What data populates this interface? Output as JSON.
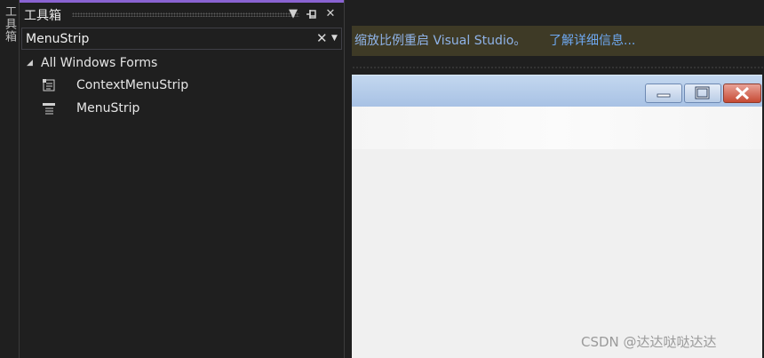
{
  "side_strip": {
    "label": "工具箱"
  },
  "toolbox": {
    "title": "工具箱",
    "search_value": "MenuStrip",
    "tree": {
      "group_label": "All Windows Forms",
      "items": [
        {
          "label": "ContextMenuStrip",
          "icon": "context-menu-strip-icon"
        },
        {
          "label": "MenuStrip",
          "icon": "menu-strip-icon"
        }
      ]
    }
  },
  "infobar": {
    "message": "缩放比例重启 Visual Studio。",
    "link": "了解详细信息..."
  },
  "watermark": "CSDN @达达哒哒达达",
  "colors": {
    "accent": "#8a63d2",
    "background": "#1f1f1f",
    "infobar_bg": "#3e3a26",
    "link": "#6ea8f0",
    "close_button": "#c64a34"
  }
}
